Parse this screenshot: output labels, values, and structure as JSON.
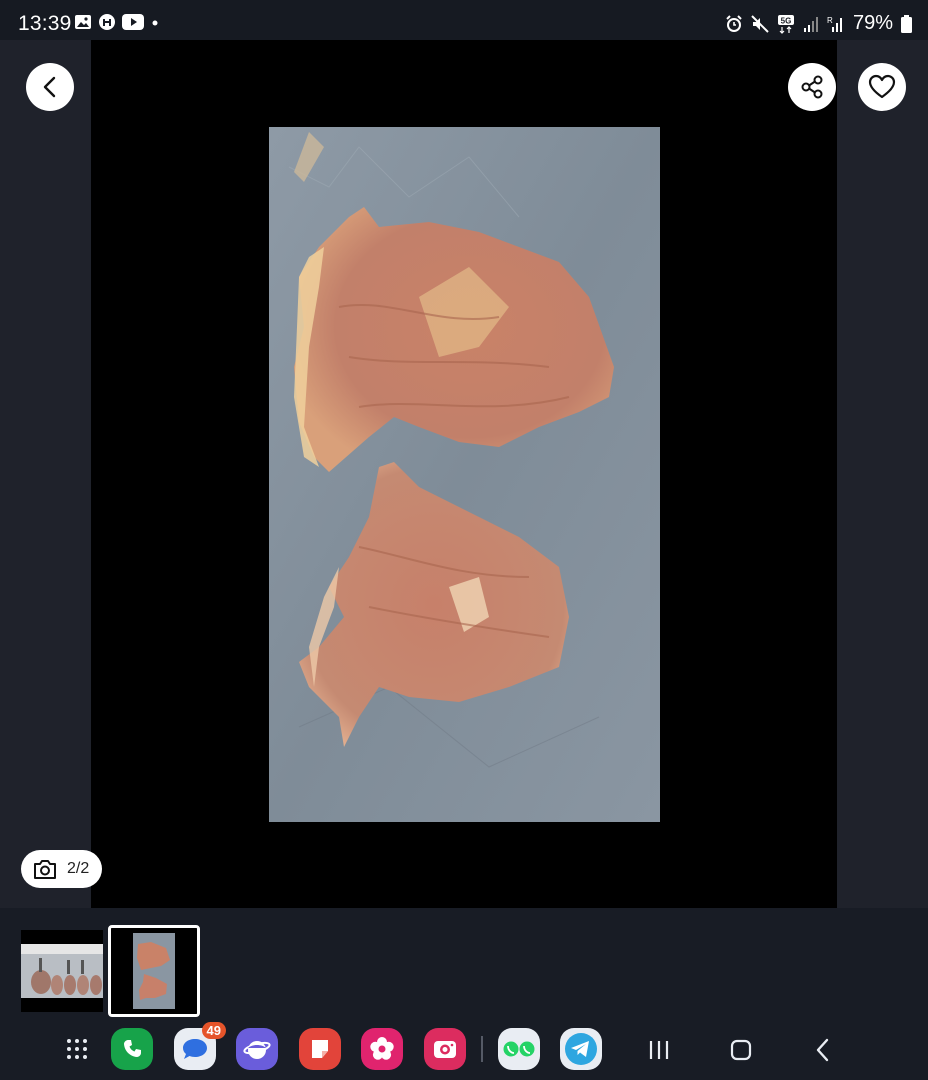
{
  "status": {
    "time": "13:39",
    "left_icons": [
      "gallery-icon",
      "ai-icon",
      "youtube-icon",
      "dot-icon"
    ],
    "right_icons": [
      "alarm-icon",
      "mute-icon",
      "5g-icon",
      "signal-icon",
      "signal-r-icon"
    ],
    "battery": "79%"
  },
  "viewer": {
    "back_icon": "chevron-left-icon",
    "share_icon": "share-icon",
    "favorite_icon": "heart-icon",
    "counter": "2/2",
    "counter_icon": "camera-icon"
  },
  "thumbnails": [
    {
      "subject": "packaged-meat-thumbnail",
      "selected": false
    },
    {
      "subject": "chicken-thighs-thumbnail",
      "selected": true
    }
  ],
  "taskbar": {
    "apps": [
      {
        "name": "apps-grid",
        "icon": "apps-grid-icon"
      },
      {
        "name": "phone",
        "icon": "phone-icon",
        "color": "#17a34a"
      },
      {
        "name": "messages",
        "icon": "messages-icon",
        "color": "#e9edf3",
        "badge": "49"
      },
      {
        "name": "internet",
        "icon": "internet-icon",
        "color": "#6a5ddb"
      },
      {
        "name": "notes",
        "icon": "notes-icon",
        "color": "#e2443a"
      },
      {
        "name": "gallery",
        "icon": "flower-icon",
        "color": "#e0246e"
      },
      {
        "name": "camera",
        "icon": "camera-app-icon",
        "color": "#dc2c5f"
      },
      {
        "name": "whatsapp-dual",
        "icon": "whatsapp-icon",
        "color": "#e9edf3"
      },
      {
        "name": "telegram",
        "icon": "telegram-icon",
        "color": "#2ea6e0"
      }
    ],
    "nav": [
      "recents-icon",
      "home-icon",
      "back-icon"
    ]
  }
}
